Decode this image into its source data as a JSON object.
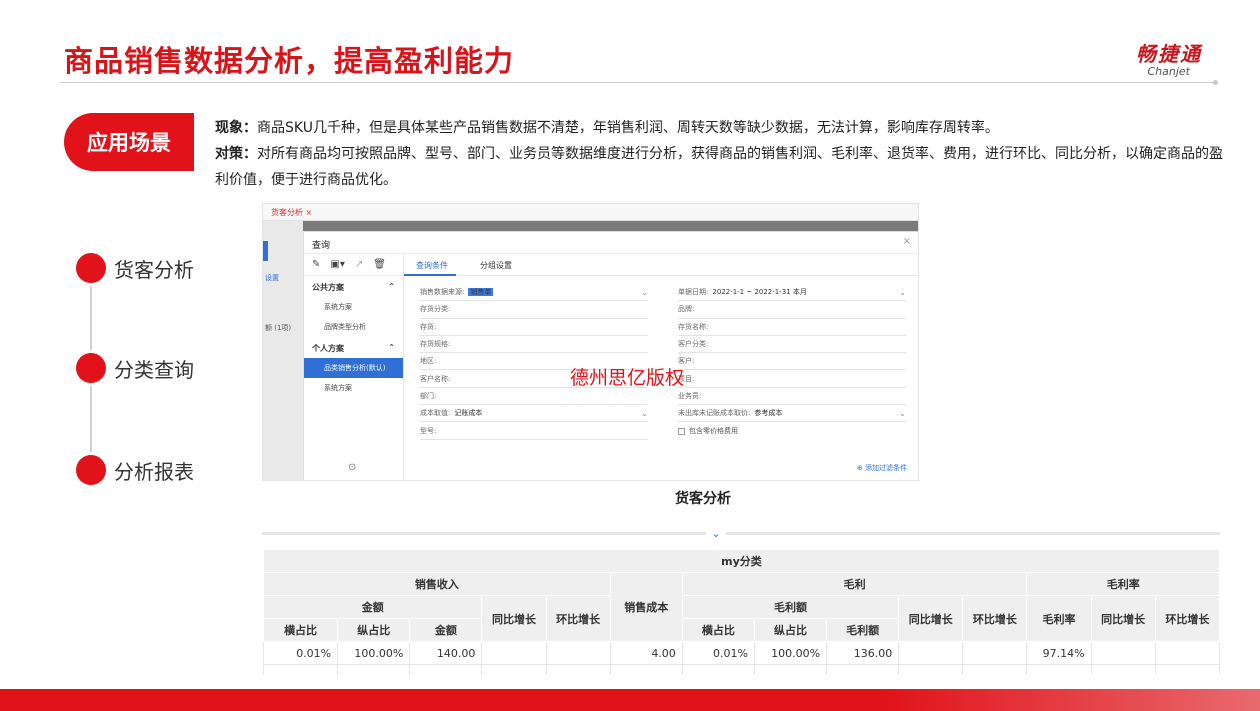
{
  "header": {
    "title": "商品销售数据分析，提高盈利能力",
    "logo_cn": "畅捷通",
    "logo_en": "Chanjet"
  },
  "scene": {
    "badge": "应用场景",
    "phenomenon_label": "现象：",
    "phenomenon_text": "商品SKU几千种，但是具体某些产品销售数据不清楚，年销售利润、周转天数等缺少数据，无法计算，影响库存周转率。",
    "solution_label": "对策：",
    "solution_text": "对所有商品均可按照品牌、型号、部门、业务员等数据维度进行分析，获得商品的销售利润、毛利率、退货率、费用，进行环比、同比分析，以确定商品的盈利价值，便于进行商品优化。"
  },
  "timeline": [
    "货客分析",
    "分类查询",
    "分析报表"
  ],
  "screenshot": {
    "tab": "货客分析",
    "side_texts": [
      "设置",
      "额 (1项)"
    ],
    "dialog_title": "查询",
    "public_group": "公共方案",
    "public_plans": [
      "系统方案",
      "品牌类型分析"
    ],
    "private_group": "个人方案",
    "private_plans": [
      "品类销售分析(默认)",
      "系统方案"
    ],
    "tabs": [
      "查询条件",
      "分组设置"
    ],
    "left_fields": [
      {
        "label": "销售数据来源:",
        "value": "销售单",
        "highlight": true,
        "dropdown": true
      },
      {
        "label": "存货分类:",
        "value": ""
      },
      {
        "label": "存货:",
        "value": ""
      },
      {
        "label": "存货规格:",
        "value": ""
      },
      {
        "label": "地区:",
        "value": ""
      },
      {
        "label": "客户名称:",
        "value": ""
      },
      {
        "label": "部门:",
        "value": ""
      },
      {
        "label": "成本取值:",
        "value": "记账成本",
        "dropdown": true
      },
      {
        "label": "型号:",
        "value": ""
      }
    ],
    "right_fields": [
      {
        "label": "单据日期:",
        "value": "2022-1-1    ~  2022-1-31         本月",
        "dropdown": true
      },
      {
        "label": "品牌:",
        "value": ""
      },
      {
        "label": "存货名称:",
        "value": ""
      },
      {
        "label": "客户分类:",
        "value": ""
      },
      {
        "label": "客户:",
        "value": ""
      },
      {
        "label": "项目:",
        "value": ""
      },
      {
        "label": "业务员:",
        "value": ""
      },
      {
        "label": "未出库未记账成本取价:",
        "value": "参考成本",
        "dropdown": true
      }
    ],
    "checkbox_label": "包含零价格费用",
    "add_filter": "添加过滤条件",
    "watermark": "德州思亿版权"
  },
  "report": {
    "title": "货客分析",
    "group_header": "my分类",
    "col_sales": "销售收入",
    "col_amount": "金额",
    "col_h_ratio": "横占比",
    "col_v_ratio": "纵占比",
    "col_amount2": "金额",
    "col_yoy": "同比增长",
    "col_mom": "环比增长",
    "col_cost": "销售成本",
    "col_gross": "毛利",
    "col_gross_amt": "毛利额",
    "col_gross_amt2": "毛利额",
    "col_margin": "毛利率",
    "col_margin_rate": "毛利率",
    "row": [
      "0.01%",
      "100.00%",
      "140.00",
      "",
      "",
      "4.00",
      "0.01%",
      "100.00%",
      "136.00",
      "",
      "",
      "97.14%",
      "",
      ""
    ]
  }
}
